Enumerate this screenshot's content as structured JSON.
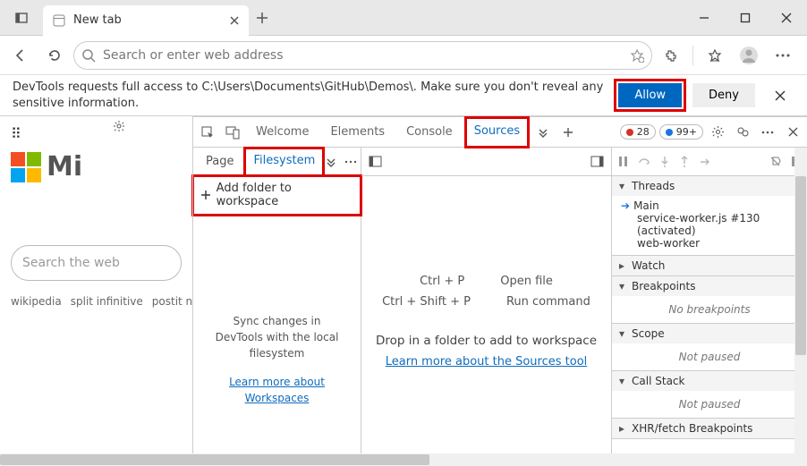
{
  "browser": {
    "tab_title": "New tab",
    "address_placeholder": "Search or enter web address"
  },
  "permission": {
    "message": "DevTools requests full access to C:\\Users\\Documents\\GitHub\\Demos\\. Make sure you don't reveal any sensitive information.",
    "allow": "Allow",
    "deny": "Deny"
  },
  "page": {
    "logo_text": "Mi",
    "search_placeholder": "Search the web",
    "links": [
      "wikipedia",
      "split infinitive",
      "postit no"
    ]
  },
  "devtools": {
    "tabs": [
      "Welcome",
      "Elements",
      "Console",
      "Sources"
    ],
    "active_tab": "Sources",
    "error_count": "28",
    "info_count": "99+",
    "sidebar": {
      "subtabs": [
        "Page",
        "Filesystem"
      ],
      "active": "Filesystem",
      "add_folder": "Add folder to workspace",
      "sync_text": "Sync changes in DevTools with the local filesystem",
      "learn_link": "Learn more about Workspaces"
    },
    "center": {
      "shortcuts": [
        {
          "keys": "Ctrl + P",
          "action": "Open file"
        },
        {
          "keys": "Ctrl + Shift + P",
          "action": "Run command"
        }
      ],
      "drop_hint": "Drop in a folder to add to workspace",
      "learn_link": "Learn more about the Sources tool"
    },
    "debugger": {
      "threads_label": "Threads",
      "threads": [
        {
          "name": "Main",
          "current": true
        },
        {
          "name": "service-worker.js #130 (activated)"
        },
        {
          "name": "web-worker"
        }
      ],
      "watch_label": "Watch",
      "breakpoints_label": "Breakpoints",
      "no_breakpoints": "No breakpoints",
      "scope_label": "Scope",
      "not_paused": "Not paused",
      "callstack_label": "Call Stack",
      "xhr_label": "XHR/fetch Breakpoints"
    }
  }
}
